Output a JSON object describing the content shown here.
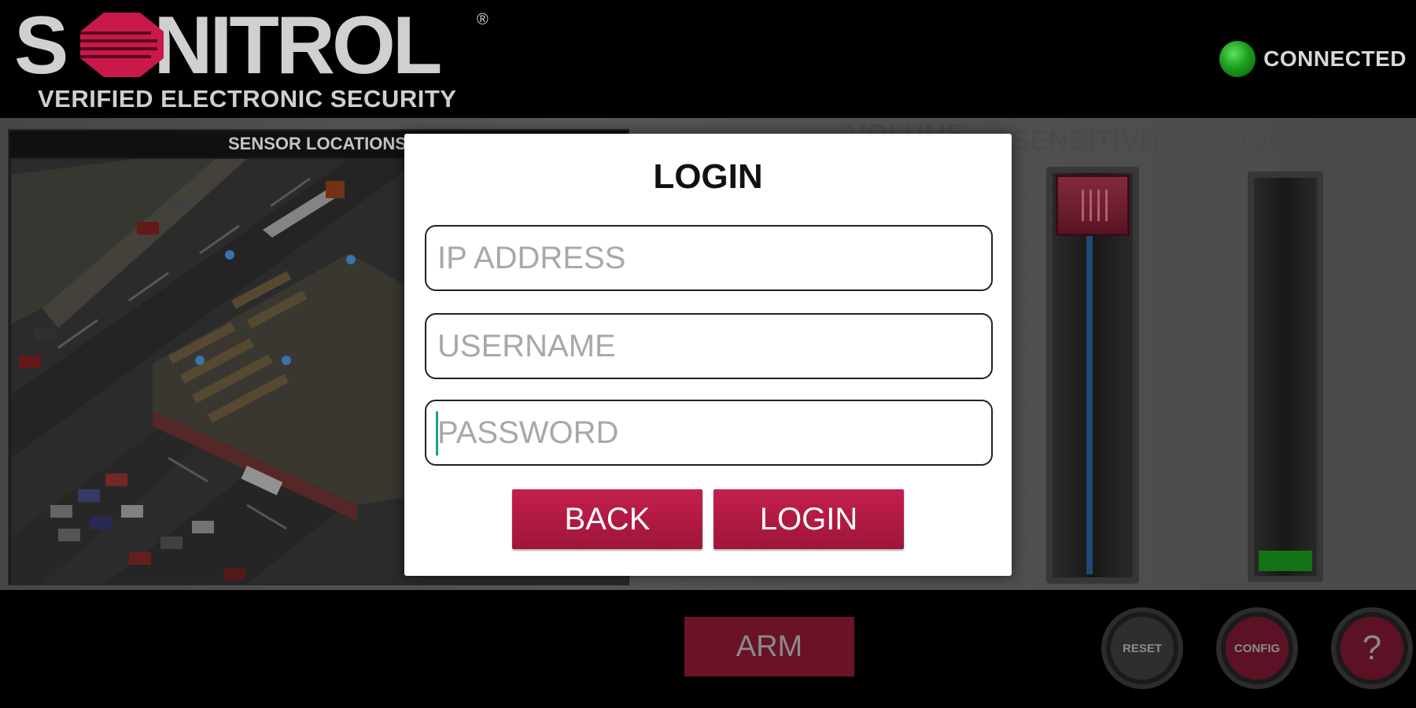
{
  "brand": {
    "name": "SONITROL",
    "name_prefix": "S",
    "name_rest": "NITROL",
    "registered_mark": "®",
    "tagline": "VERIFIED ELECTRONIC SECURITY",
    "accent_color": "#c8194a"
  },
  "status": {
    "label": "CONNECTED",
    "color": "#1e9e1e"
  },
  "map": {
    "title": "SENSOR LOCATIONS"
  },
  "controls": {
    "volume_label": "VOLUME",
    "sensitivity_label": "SENSITIVITY",
    "sound_level_label": "SOUND LEVEL",
    "sensitivity_value": 1.0,
    "sound_level_value": 0.05
  },
  "bottom": {
    "arm_label": "ARM",
    "reset_label": "RESET",
    "config_label": "CONFIG",
    "help_label": "?"
  },
  "dialog": {
    "title": "LOGIN",
    "ip_placeholder": "IP ADDRESS",
    "username_placeholder": "USERNAME",
    "password_placeholder": "PASSWORD",
    "back_label": "BACK",
    "login_label": "LOGIN"
  }
}
